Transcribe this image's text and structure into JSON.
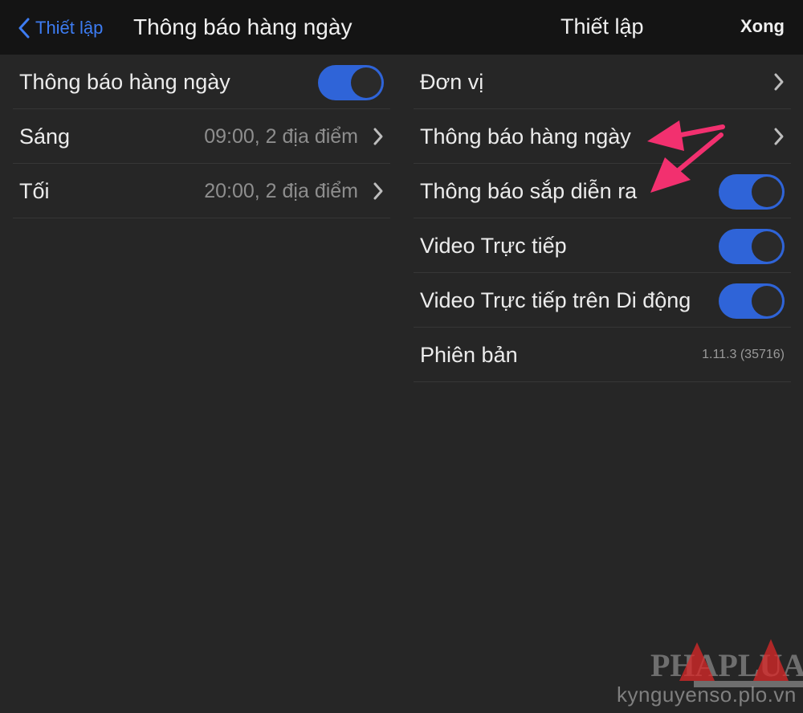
{
  "left": {
    "back_label": "Thiết lập",
    "title": "Thông báo hàng ngày",
    "rows": [
      {
        "label": "Thông báo hàng ngày",
        "toggle_on": true
      },
      {
        "label": "Sáng",
        "value": "09:00, 2 địa điểm"
      },
      {
        "label": "Tối",
        "value": "20:00, 2 địa điểm"
      }
    ]
  },
  "right": {
    "title": "Thiết lập",
    "done_label": "Xong",
    "rows": [
      {
        "label": "Đơn vị"
      },
      {
        "label": "Thông báo hàng ngày"
      },
      {
        "label": "Thông báo sắp diễn ra",
        "toggle_on": true
      },
      {
        "label": "Video Trực tiếp",
        "toggle_on": true
      },
      {
        "label": "Video Trực tiếp trên Di động",
        "toggle_on": true
      },
      {
        "label": "Phiên bản",
        "value": "1.11.3 (35716)"
      }
    ]
  },
  "watermark": {
    "brand": "PHÁP LUẬT",
    "url": "kynguyenso.plo.vn"
  },
  "colors": {
    "accent_blue": "#2f64d8",
    "link_blue": "#3d7cf2",
    "arrow_pink": "#f2306f",
    "background": "#262626",
    "navbar": "#141414"
  }
}
